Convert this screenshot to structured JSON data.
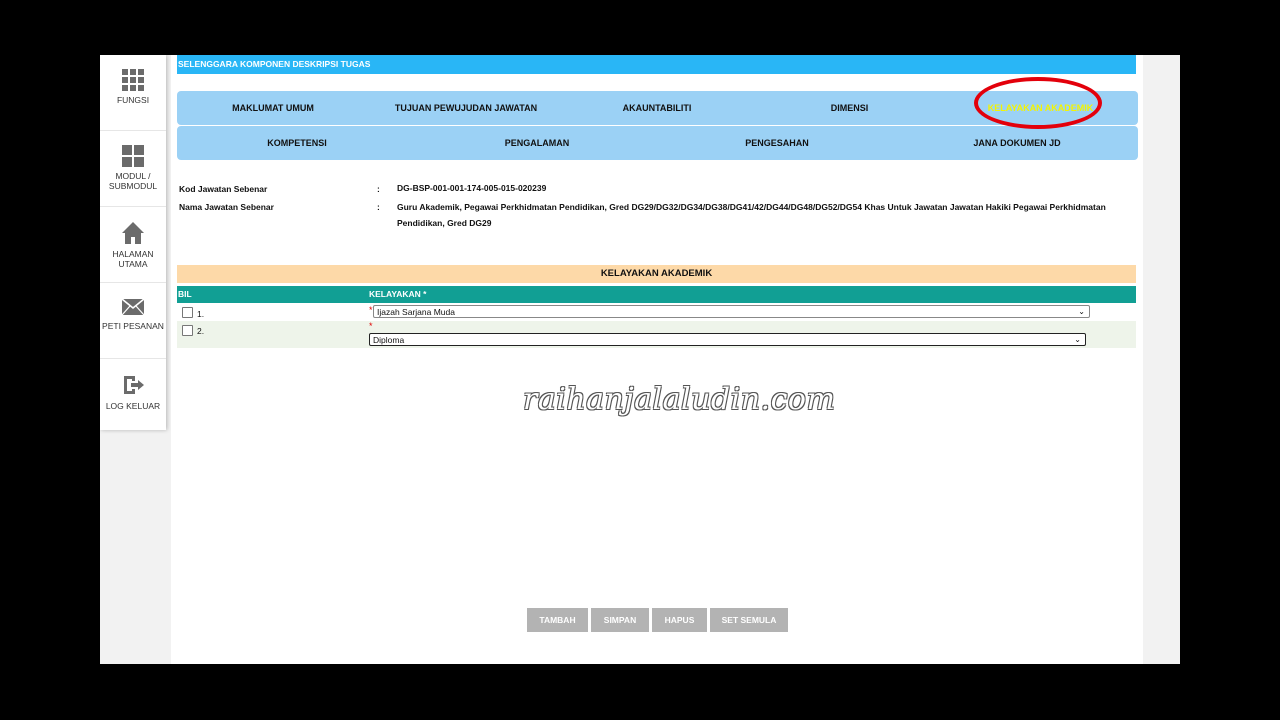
{
  "sidebar": {
    "items": [
      {
        "label": "FUNGSI",
        "icon": "grid-icon"
      },
      {
        "label": "MODUL / SUBMODUL",
        "icon": "modules-icon"
      },
      {
        "label": "HALAMAN UTAMA",
        "icon": "home-icon"
      },
      {
        "label": "PETI PESANAN",
        "icon": "mail-icon"
      },
      {
        "label": "LOG KELUAR",
        "icon": "logout-icon"
      }
    ]
  },
  "page_title": "SELENGGARA KOMPONEN DESKRIPSI TUGAS",
  "tabs_row1": [
    "MAKLUMAT UMUM",
    "TUJUAN PEWUJUDAN JAWATAN",
    "AKAUNTABILITI",
    "DIMENSI",
    "KELAYAKAN AKADEMIK"
  ],
  "tabs_row2": [
    "KOMPETENSI",
    "PENGALAMAN",
    "PENGESAHAN",
    "JANA DOKUMEN JD"
  ],
  "active_tab": "KELAYAKAN AKADEMIK",
  "info": {
    "kod_label": "Kod Jawatan Sebenar",
    "kod_value": "DG-BSP-001-001-174-005-015-020239",
    "nama_label": "Nama Jawatan Sebenar",
    "nama_value_line1": "Guru Akademik, Pegawai Perkhidmatan Pendidikan, Gred DG29/DG32/DG34/DG38/DG41/42/DG44/DG48/DG52/DG54 Khas Untuk Jawatan Jawatan Hakiki Pegawai Perkhidmatan",
    "nama_value_line2": "Pendidikan, Gred DG29",
    "colon": ":"
  },
  "section_title": "KELAYAKAN AKADEMIK",
  "table": {
    "headers": {
      "bil": "BIL",
      "kelayakan": "KELAYAKAN *"
    },
    "rows": [
      {
        "num": "1.",
        "value": "Ijazah Sarjana Muda"
      },
      {
        "num": "2.",
        "value": "Diploma"
      }
    ]
  },
  "watermark": "raihanjalaludin.com",
  "buttons": [
    "TAMBAH",
    "SIMPAN",
    "HAPUS",
    "SET SEMULA"
  ],
  "colors": {
    "title_bar": "#29b6f6",
    "tab_bg": "#9bd1f5",
    "active_tab_text": "#f4f400",
    "section_bg": "#fdd9a8",
    "table_header": "#119f94",
    "button_bg": "#b3b3b3",
    "highlight_ring": "#e3000b"
  }
}
